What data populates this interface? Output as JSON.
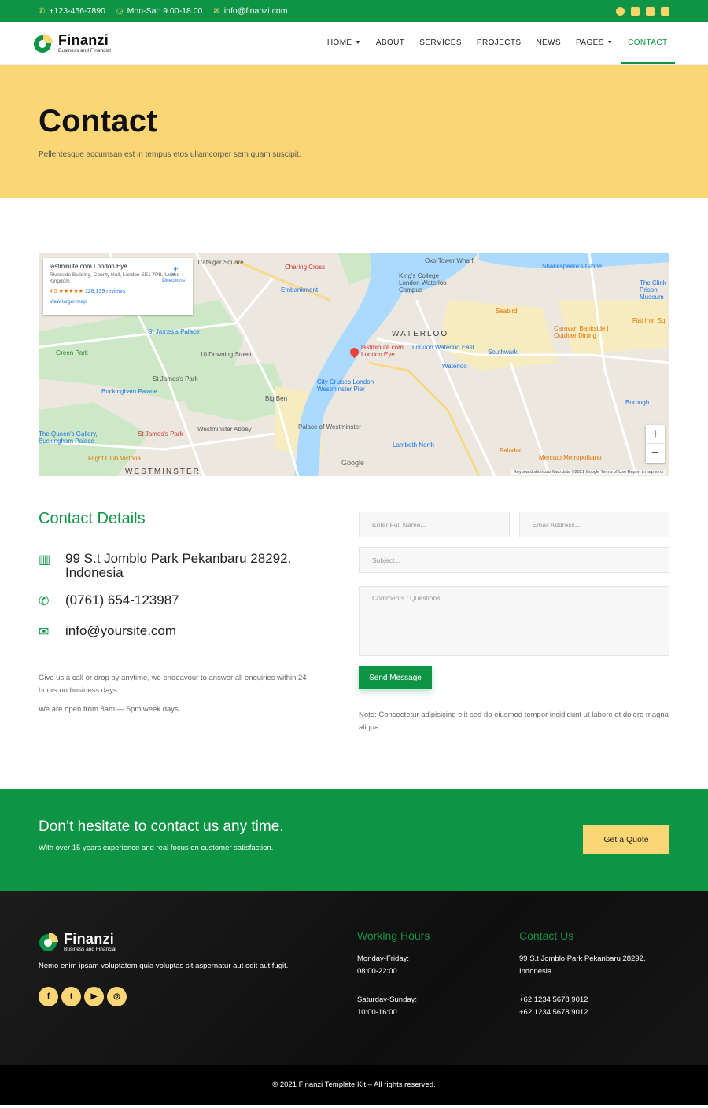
{
  "topbar": {
    "phone": "+123-456-7890",
    "hours": "Mon-Sat: 9.00-18.00",
    "email": "info@finanzi.com"
  },
  "brand": {
    "name": "Finanzi",
    "tagline": "Business and Financial",
    "green": "#0d9444",
    "yellow": "#fbd674"
  },
  "nav": {
    "items": [
      {
        "label": "HOME",
        "dropdown": true
      },
      {
        "label": "ABOUT",
        "dropdown": false
      },
      {
        "label": "SERVICES",
        "dropdown": false
      },
      {
        "label": "PROJECTS",
        "dropdown": false
      },
      {
        "label": "NEWS",
        "dropdown": false
      },
      {
        "label": "PAGES",
        "dropdown": true
      },
      {
        "label": "CONTACT",
        "dropdown": false,
        "active": true
      }
    ]
  },
  "hero": {
    "title": "Contact",
    "subtitle": "Pellentesque accumsan est in tempus etos ullamcorper sem quam suscipit."
  },
  "map": {
    "card_title": "lastminute.com London Eye",
    "card_address": "Riverside Building, County Hall, London SE1 7PB, United Kingdom",
    "card_rating": "4.5 ★★★★★",
    "card_reviews": "128,139 reviews",
    "card_link": "View larger map",
    "card_directions": "Directions",
    "labels": {
      "trafalgar": "Trafalgar Square",
      "charing": "Charing Cross",
      "embankment": "Embankment",
      "oxo": "Oxo Tower Wharf",
      "shakespeare": "Shakespeare's Globe",
      "kings": "King's College London Waterloo Campus",
      "waterloo": "WATERLOO",
      "eye": "lastminute.com London Eye",
      "stjames": "St James's Palace",
      "downing": "10 Downing Street",
      "buckingham": "Buckingham Palace",
      "bigben": "Big Ben",
      "westminster_abbey": "Westminster Abbey",
      "palace_westminster": "Palace of Westminster",
      "westminster": "WESTMINSTER",
      "lambeth": "Lambeth North",
      "southwark": "Southwark",
      "borough": "Borough",
      "mercato": "Mercato Metropolitano",
      "flight": "Flight Club Victoria",
      "queens": "The Queen's Gallery, Buckingham Palace",
      "green_park": "Green Park",
      "seabird": "Seabird",
      "caravan": "Caravan Bankside | Outdoor Dining",
      "cruises": "City Cruises London Westminster Pier",
      "stjamespark": "St James's Park",
      "waterloo_st": "Waterloo",
      "waterloo_east": "London Waterloo East",
      "paladar": "Paladar",
      "clink": "The Clink Prison Museum",
      "flatiron": "Flat Iron Sq"
    },
    "footer": "Keyboard shortcuts   Map data ©2021 Google   Terms of Use   Report a map error",
    "google": "Google",
    "zoom_in": "+",
    "zoom_out": "−"
  },
  "details": {
    "heading": "Contact Details",
    "address": "99 S.t Jomblo Park Pekanbaru 28292. Indonesia",
    "phone": "(0761) 654-123987",
    "email": "info@yoursite.com",
    "para1": "Give us a call or drop by anytime, we endeavour to answer all enquiries within 24 hours on business days.",
    "para2": "We are open from 8am — 5pm week days."
  },
  "form": {
    "name_placeholder": "Enter Full Name...",
    "email_placeholder": "Email Address...",
    "subject_placeholder": "Subject...",
    "comments_placeholder": "Comments / Questions",
    "submit": "Send Message",
    "note": "Note: Consectetur adipisicing elit sed do eiusmod tempor incididunt ut labore et dolore magna aliqua."
  },
  "cta": {
    "title": "Don’t hesitate to contact us any time.",
    "subtitle": "With over 15 years experience and real focus on customer satisfaction.",
    "button": "Get a Quote"
  },
  "footer": {
    "about": "Nemo enim ipsam voluptatem quia voluptas sit aspernatur aut odit aut fugit.",
    "hours_heading": "Working Hours",
    "weekday_label": "Monday-Friday:",
    "weekday_hours": "08:00-22:00",
    "weekend_label": "Saturday-Sunday:",
    "weekend_hours": "10:00-16:00",
    "contact_heading": "Contact Us",
    "address_line1": "99 S.t Jomblo Park Pekanbaru 28292.",
    "address_line2": "Indonesia",
    "phone1": "+62 1234 5678 9012",
    "phone2": "+62 1234 5678 9012",
    "copyright": "© 2021 Finanzi Template Kit – All rights reserved."
  }
}
